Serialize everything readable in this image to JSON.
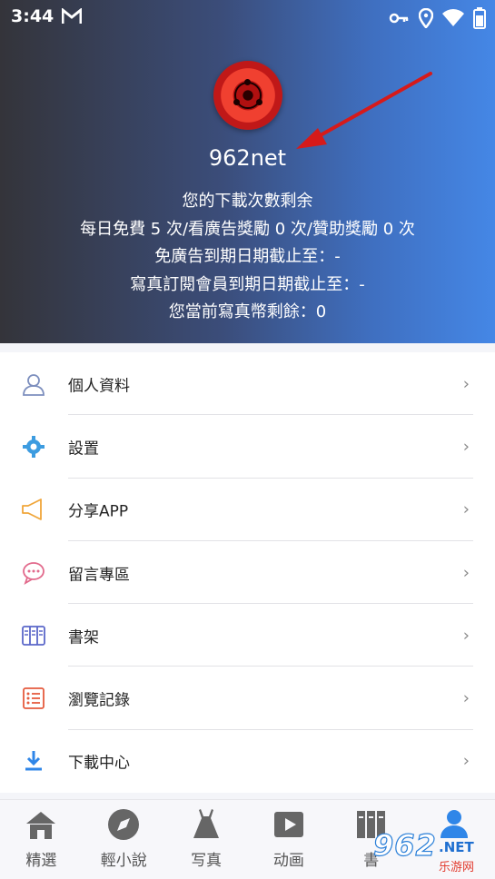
{
  "status_bar": {
    "time": "3:44",
    "left_icons": [
      "gmail-icon"
    ],
    "right_icons": [
      "vpn-key-icon",
      "location-icon",
      "wifi-icon",
      "battery-icon"
    ]
  },
  "profile": {
    "username": "962net",
    "download_title": "您的下載次數剩余",
    "download_counts": "每日免費 5 次/看廣告獎勵 0 次/贊助獎勵 0 次",
    "ad_free_expiry": "免廣告到期日期截止至：-",
    "photo_member_expiry": "寫真訂閱會員到期日期截止至：-",
    "photo_coins": "您當前寫真幣剩餘：0"
  },
  "menu": {
    "items": [
      {
        "label": "個人資料",
        "icon": "user-icon"
      },
      {
        "label": "設置",
        "icon": "gear-icon"
      },
      {
        "label": "分享APP",
        "icon": "megaphone-icon"
      },
      {
        "label": "留言專區",
        "icon": "chat-icon"
      },
      {
        "label": "書架",
        "icon": "bookshelf-icon"
      },
      {
        "label": "瀏覽記錄",
        "icon": "history-list-icon"
      },
      {
        "label": "下載中心",
        "icon": "download-icon"
      }
    ]
  },
  "tabbar": {
    "tabs": [
      {
        "label": "精選",
        "icon": "home-icon"
      },
      {
        "label": "輕小說",
        "icon": "compass-icon"
      },
      {
        "label": "写真",
        "icon": "dress-icon"
      },
      {
        "label": "动画",
        "icon": "play-icon"
      },
      {
        "label": "書",
        "icon": "books-icon"
      },
      {
        "label": "",
        "icon": "person-icon"
      }
    ],
    "active_color": "#2f86e8"
  },
  "watermark": {
    "brand": "962",
    "net": ".NET",
    "sub": "乐游网"
  }
}
